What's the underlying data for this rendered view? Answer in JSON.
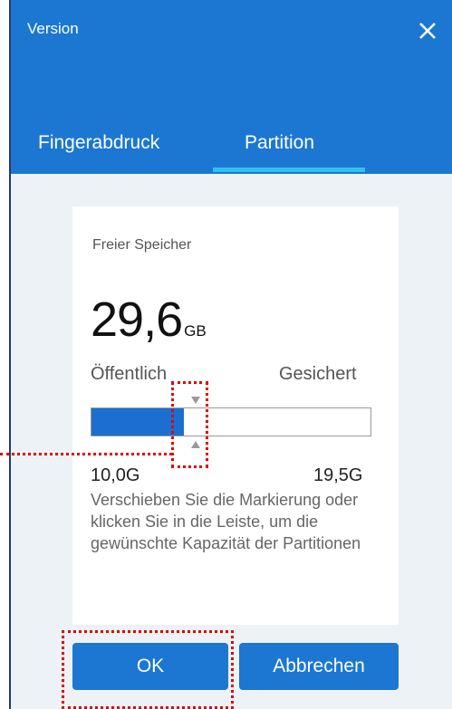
{
  "window": {
    "title": "Version",
    "close_icon": "close-icon"
  },
  "tabs": [
    {
      "label": "Fingerabdruck",
      "active": false
    },
    {
      "label": "Partition",
      "active": true
    }
  ],
  "storage": {
    "label": "Freier Speicher",
    "capacity_value": "29,6",
    "capacity_unit": "GB",
    "public_label": "Öffentlich",
    "secure_label": "Gesichert",
    "public_size": "10,0G",
    "secure_size": "19,5G",
    "public_fraction": 0.33,
    "help_text": "Verschieben Sie die Markierung oder klicken Sie in die Leiste, um die gewünschte Kapazität der Partitionen"
  },
  "buttons": {
    "ok_label": "OK",
    "cancel_label": "Abbrechen"
  },
  "colors": {
    "primary": "#1b77d2",
    "tab_indicator": "#31c1ef",
    "bar_fill": "#1b6fd0",
    "annotation": "#e00000"
  }
}
